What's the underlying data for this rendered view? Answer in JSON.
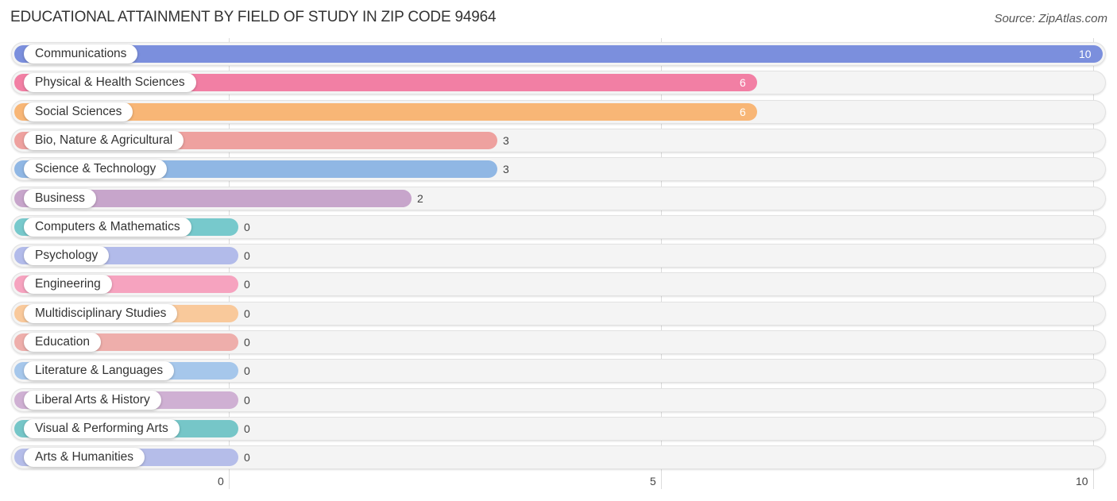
{
  "header": {
    "title": "EDUCATIONAL ATTAINMENT BY FIELD OF STUDY IN ZIP CODE 94964",
    "source": "Source: ZipAtlas.com"
  },
  "chart_data": {
    "type": "bar",
    "orientation": "horizontal",
    "title": "EDUCATIONAL ATTAINMENT BY FIELD OF STUDY IN ZIP CODE 94964",
    "xlabel": "",
    "ylabel": "",
    "xlim": [
      0,
      10
    ],
    "xticks": [
      0,
      5,
      10
    ],
    "xtick_labels": [
      "0",
      "5",
      "10"
    ],
    "grid": true,
    "categories": [
      "Communications",
      "Physical & Health Sciences",
      "Social Sciences",
      "Bio, Nature & Agricultural",
      "Science & Technology",
      "Business",
      "Computers & Mathematics",
      "Psychology",
      "Engineering",
      "Multidisciplinary Studies",
      "Education",
      "Literature & Languages",
      "Liberal Arts & History",
      "Visual & Performing Arts",
      "Arts & Humanities"
    ],
    "values": [
      10,
      6,
      6,
      3,
      3,
      2,
      0,
      0,
      0,
      0,
      0,
      0,
      0,
      0,
      0
    ],
    "value_labels": [
      "10",
      "6",
      "6",
      "3",
      "3",
      "2",
      "0",
      "0",
      "0",
      "0",
      "0",
      "0",
      "0",
      "0",
      "0"
    ],
    "colors": [
      "#7b8fdd",
      "#f27fa4",
      "#f8b676",
      "#eea19f",
      "#90b7e4",
      "#c7a5cb",
      "#77c9cc",
      "#b2bbea",
      "#f6a3bf",
      "#f9c99b",
      "#eeaeab",
      "#a6c7eb",
      "#cfb0d3",
      "#76c6c8",
      "#b5bde9"
    ]
  }
}
